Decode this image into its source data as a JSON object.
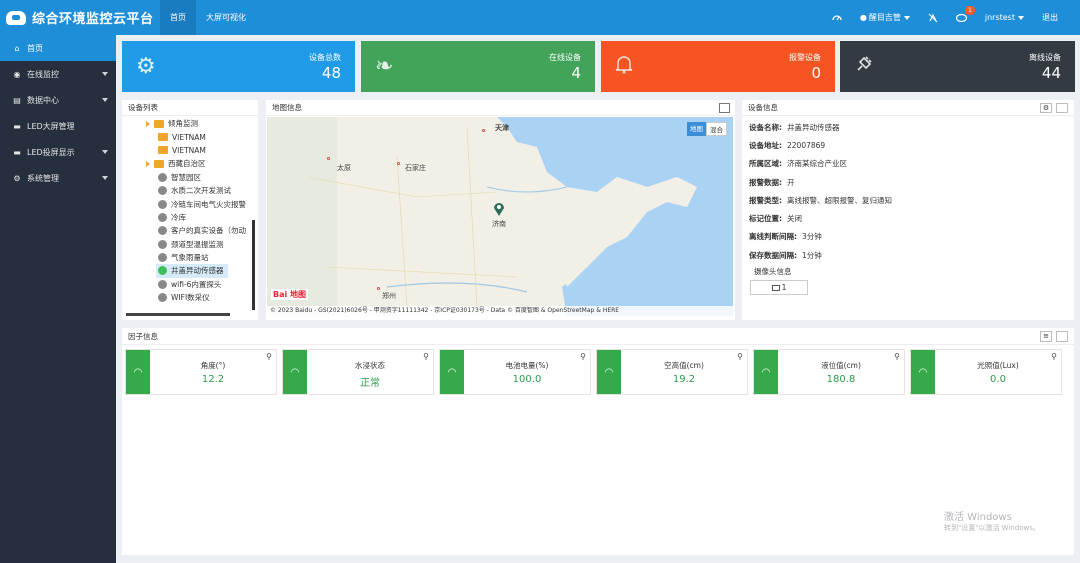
{
  "header": {
    "title": "综合环境监控云平台",
    "nav": [
      "首页",
      "大屏可视化"
    ],
    "region_label": "醒目吉管",
    "notification_count": "1",
    "username": "jnrstest",
    "logout": "退出"
  },
  "sidebar": {
    "items": [
      {
        "label": "首页",
        "icon": "home-icon"
      },
      {
        "label": "在线监控",
        "icon": "globe-icon"
      },
      {
        "label": "数据中心",
        "icon": "table-icon"
      },
      {
        "label": "LED大屏管理",
        "icon": "monitor-icon"
      },
      {
        "label": "LED投屏显示",
        "icon": "monitor-icon"
      },
      {
        "label": "系统管理",
        "icon": "gear-icon"
      }
    ]
  },
  "stats": [
    {
      "label": "设备总数",
      "value": "48",
      "color": "#1f9be8",
      "icon": "gears-icon"
    },
    {
      "label": "在线设备",
      "value": "4",
      "color": "#43a35a",
      "icon": "leaf-icon"
    },
    {
      "label": "报警设备",
      "value": "0",
      "color": "#f75424",
      "icon": "bell-icon"
    },
    {
      "label": "离线设备",
      "value": "44",
      "color": "#333a42",
      "icon": "plug-icon"
    }
  ],
  "device_list": {
    "title": "设备列表",
    "items": [
      {
        "label": "倾角监测",
        "type": "folder-open"
      },
      {
        "label": "VIETNAM",
        "type": "folder"
      },
      {
        "label": "VIETNAM",
        "type": "folder"
      },
      {
        "label": "西藏自治区",
        "type": "folder-open"
      },
      {
        "label": "智慧园区",
        "type": "device"
      },
      {
        "label": "水质二次开发测试",
        "type": "device"
      },
      {
        "label": "冷链车间电气火灾报警",
        "type": "device"
      },
      {
        "label": "冷库",
        "type": "device"
      },
      {
        "label": "客户的真实设备（勿动",
        "type": "device"
      },
      {
        "label": "颈道型温振监测",
        "type": "device"
      },
      {
        "label": "气象雨量站",
        "type": "device"
      },
      {
        "label": "井盖异动传感器",
        "type": "device-online"
      },
      {
        "label": "wifi-6内置探头",
        "type": "device"
      },
      {
        "label": "WIFI数采仪",
        "type": "device"
      }
    ]
  },
  "map": {
    "title": "地图信息",
    "type_buttons": [
      "地图",
      "混合"
    ],
    "cities": [
      "天津",
      "太原",
      "石家庄",
      "济南",
      "郑州"
    ],
    "marker_city": "济南",
    "copyright": "© 2023 Baidu - GS(2021)6026号 - 甲测资字11111342 - 京ICP证030173号 - Data © 百度智图 & OpenStreetMap & HERE",
    "logo": "Bai 地图"
  },
  "device_info": {
    "title": "设备信息",
    "rows": [
      {
        "k": "设备名称:",
        "v": "井盖异动传感器"
      },
      {
        "k": "设备地址:",
        "v": "22007869"
      },
      {
        "k": "所属区域:",
        "v": "济南某综合产业区"
      },
      {
        "k": "报警数据:",
        "v": "开"
      },
      {
        "k": "报警类型:",
        "v": "离线报警、超限报警、复归通知"
      },
      {
        "k": "标记位置:",
        "v": "关闭"
      },
      {
        "k": "离线判断间隔:",
        "v": "3分钟"
      },
      {
        "k": "保存数据间隔:",
        "v": "1分钟"
      }
    ],
    "camera_label": "摄像头信息",
    "camera_count": "1"
  },
  "factor": {
    "title": "因子信息",
    "items": [
      {
        "name": "角度(°)",
        "value": "12.2"
      },
      {
        "name": "水浸状态",
        "value": "正常"
      },
      {
        "name": "电池电量(%)",
        "value": "100.0"
      },
      {
        "name": "空高值(cm)",
        "value": "19.2"
      },
      {
        "name": "液位值(cm)",
        "value": "180.8"
      },
      {
        "name": "光照值(Lux)",
        "value": "0.0"
      }
    ]
  },
  "windows_watermark": {
    "line1": "激活 Windows",
    "line2": "转到\"设置\"以激活 Windows。"
  }
}
